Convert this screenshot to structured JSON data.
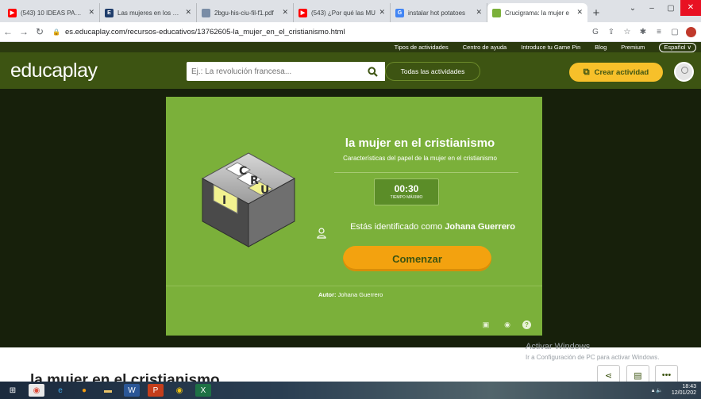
{
  "browser": {
    "tabs": [
      {
        "title": "(543) 10 IDEAS PARA E",
        "icon": "youtube-icon",
        "color": "#ff0000"
      },
      {
        "title": "Las mujeres en los orig",
        "icon": "e-icon",
        "color": "#1f3d6b"
      },
      {
        "title": "2bgu-his-ciu-fil-f1.pdf",
        "icon": "pdf-icon",
        "color": "#7a8da6"
      },
      {
        "title": "(543) ¿Por qué las MU",
        "icon": "youtube-icon",
        "color": "#ff0000"
      },
      {
        "title": "instalar hot potatoes",
        "icon": "google-icon",
        "color": "#4285f4"
      },
      {
        "title": "Crucigrama: la mujer e",
        "icon": "educaplay-icon",
        "color": "#7bb03a"
      }
    ],
    "new_tab": "+",
    "url": "es.educaplay.com/recursos-educativos/13762605-la_mujer_en_el_cristianismo.html"
  },
  "site": {
    "topbar": [
      "Tipos de actividades",
      "Centro de ayuda",
      "Introduce tu Game Pin",
      "Blog",
      "Premium"
    ],
    "language": "Español ∨",
    "logo": "educaplay",
    "search_placeholder": "Ej.: La revolución francesa...",
    "all_activities": "Todas las actividades",
    "create_activity": "Crear actividad"
  },
  "activity": {
    "title": "la mujer en el cristianismo",
    "subtitle": "Características del papel de la mujer en el cristianismo",
    "timer": "00:30",
    "timer_label": "TIEMPO MÁXIMO",
    "identified_prefix": "Estás identificado como",
    "user_name": "Johana Guerrero",
    "start_button": "Comenzar",
    "author_label": "Autor:",
    "author_name": "Johana Guerrero",
    "cube_letters": [
      "C",
      "R",
      "U",
      "I"
    ]
  },
  "page": {
    "heading": "la mujer en el cristianismo",
    "watermark_title": "Activar Windows",
    "watermark_sub": "Ir a Configuración de PC para activar Windows."
  },
  "taskbar": {
    "time": "18:43",
    "date": "12/01/202"
  }
}
